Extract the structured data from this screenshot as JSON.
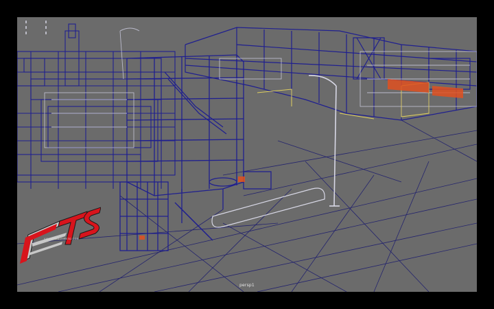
{
  "viewport": {
    "camera_name": "persp1",
    "background_color": "#6b6b6b",
    "wire_color": "#1f1f8f",
    "highlight_color": "#e0d060",
    "accent_color": "#e05020"
  },
  "watermark": {
    "logo_text": "RTS",
    "tagline": "VISIONREALTIME3D.COM",
    "colors": {
      "red": "#d8141c",
      "silver": "#c8c8c8",
      "dark": "#1a1a1a"
    }
  }
}
